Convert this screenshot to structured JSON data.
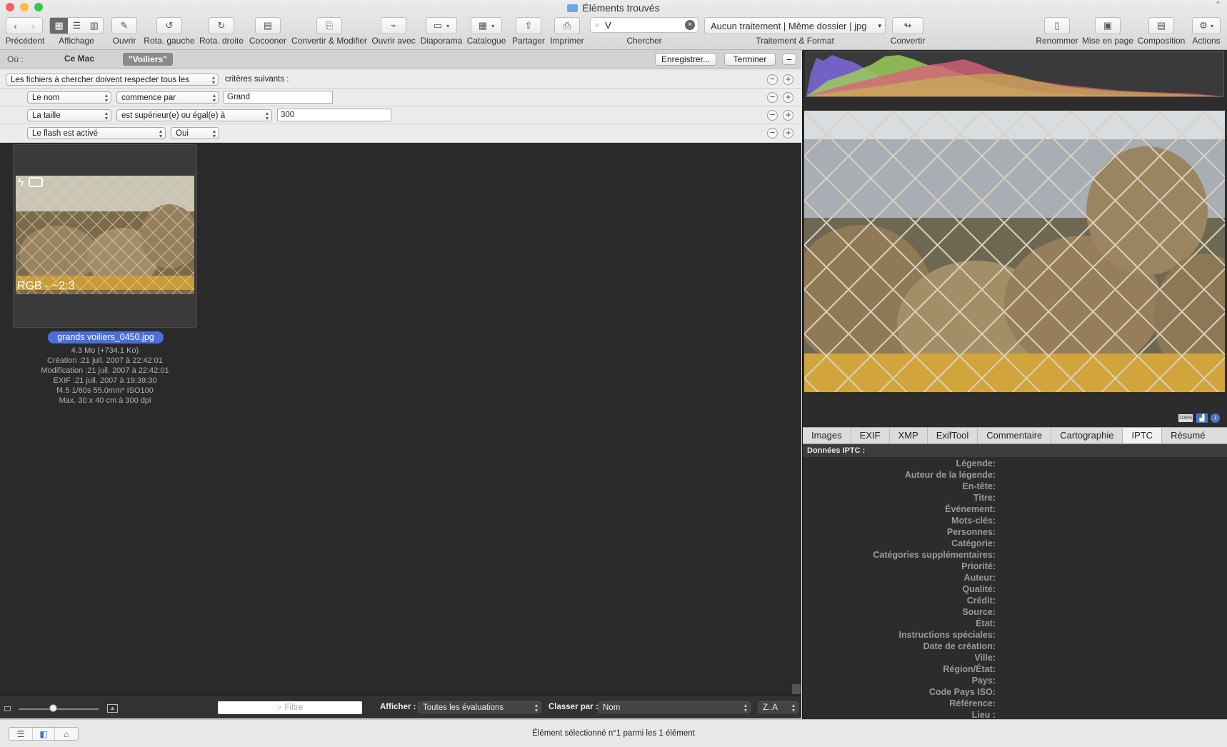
{
  "window": {
    "title": "Éléments trouvés"
  },
  "toolbar": {
    "items": [
      {
        "label": "Précédent"
      },
      {
        "label": "Affichage"
      },
      {
        "label": "Ouvrir"
      },
      {
        "label": "Rota. gauche"
      },
      {
        "label": "Rota. droite"
      },
      {
        "label": "Cocooner"
      },
      {
        "label": "Convertir & Modifier"
      },
      {
        "label": "Ouvrir avec"
      },
      {
        "label": "Diaporama"
      },
      {
        "label": "Catalogue"
      },
      {
        "label": "Partager"
      },
      {
        "label": "Imprimer"
      },
      {
        "label": "Chercher"
      },
      {
        "label": "Traitement & Format"
      },
      {
        "label": "Convertir"
      },
      {
        "label": "Renommer"
      },
      {
        "label": "Mise en page"
      },
      {
        "label": "Composition"
      },
      {
        "label": "Actions"
      }
    ],
    "search_value": "V",
    "format_value": "Aucun traitement | Même dossier | jpg"
  },
  "find": {
    "where_label": "Où :",
    "scope_mac": "Ce Mac",
    "scope_folder": "\"Voiliers\"",
    "save_label": "Enregistrer...",
    "done_label": "Terminer",
    "rule_all": "Les fichiers à chercher doivent respecter tous les",
    "rule_suffix": "critères suivants :",
    "criteria": [
      {
        "field": "Le nom",
        "op": "commence par",
        "value": "Grand"
      },
      {
        "field": "La taille",
        "op": "est supérieur(e) ou égal(e) à",
        "value": "300"
      },
      {
        "field": "Le flash est activé",
        "op": "Oui",
        "value": ""
      }
    ]
  },
  "thumb": {
    "overlay": "RGB - ~2:3",
    "filename": "grands voiliers_0450.jpg",
    "size": "4.3  Mo (+734.1 Ko)",
    "created": "Création :21 juil. 2007 à 22:42:01",
    "modified": "Modification :21 juil. 2007 à 22:42:01",
    "exif": "EXIF :21 juil. 2007 à 19:39:30",
    "shot": "f4.5 1/60s 55.0mm* ISO100",
    "max": "Max. 30 x 40 cm à 300 dpi"
  },
  "bottom": {
    "filter_placeholder": "Filtre",
    "show_label": "Afficher :",
    "show_value": "Toutes les évaluations",
    "sort_label": "Classer par :",
    "sort_value": "Nom",
    "order_value": "Z..A"
  },
  "status": {
    "text": "Élément sélectionné n°1 parmi les 1 élément"
  },
  "right": {
    "zoom_badge": "100%",
    "tabs": [
      "Images",
      "EXIF",
      "XMP",
      "ExifTool",
      "Commentaire",
      "Cartographie",
      "IPTC",
      "Résumé"
    ],
    "iptc_title": "Données IPTC :",
    "iptc_fields": [
      "Légende:",
      "Auteur de la légende:",
      "En-tête:",
      "Titre:",
      "Événement:",
      "Mots-clés:",
      "Personnes:",
      "Catégorie:",
      "Catégories supplémentaires:",
      "Priorité:",
      "Auteur:",
      "Qualité:",
      "Crédit:",
      "Source:",
      "État:",
      "Instructions spéciales:",
      "Date de création:",
      "Ville:",
      "Région/État:",
      "Pays:",
      "Code Pays ISO:",
      "Référence:",
      "Lieu :"
    ]
  },
  "colors": {
    "selection": "#4a6fd6",
    "dark_bg": "#2a2a2a"
  }
}
